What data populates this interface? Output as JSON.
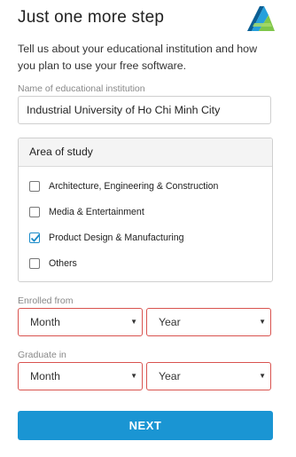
{
  "header": {
    "title": "Just one more step"
  },
  "intro": "Tell us about your educational institution and how you plan to use your free software.",
  "institution": {
    "label": "Name of educational institution",
    "value": "Industrial University of Ho Chi Minh City"
  },
  "study": {
    "heading": "Area of study",
    "options": [
      {
        "label": "Architecture, Engineering & Construction",
        "checked": false
      },
      {
        "label": "Media & Entertainment",
        "checked": false
      },
      {
        "label": "Product Design & Manufacturing",
        "checked": true
      },
      {
        "label": "Others",
        "checked": false
      }
    ]
  },
  "enrolled": {
    "label": "Enrolled from",
    "month": "Month",
    "year": "Year"
  },
  "graduate": {
    "label": "Graduate in",
    "month": "Month",
    "year": "Year"
  },
  "next_label": "NEXT",
  "colors": {
    "accent": "#1a95d3",
    "error_border": "#d9534f",
    "check": "#1a8bc9"
  }
}
